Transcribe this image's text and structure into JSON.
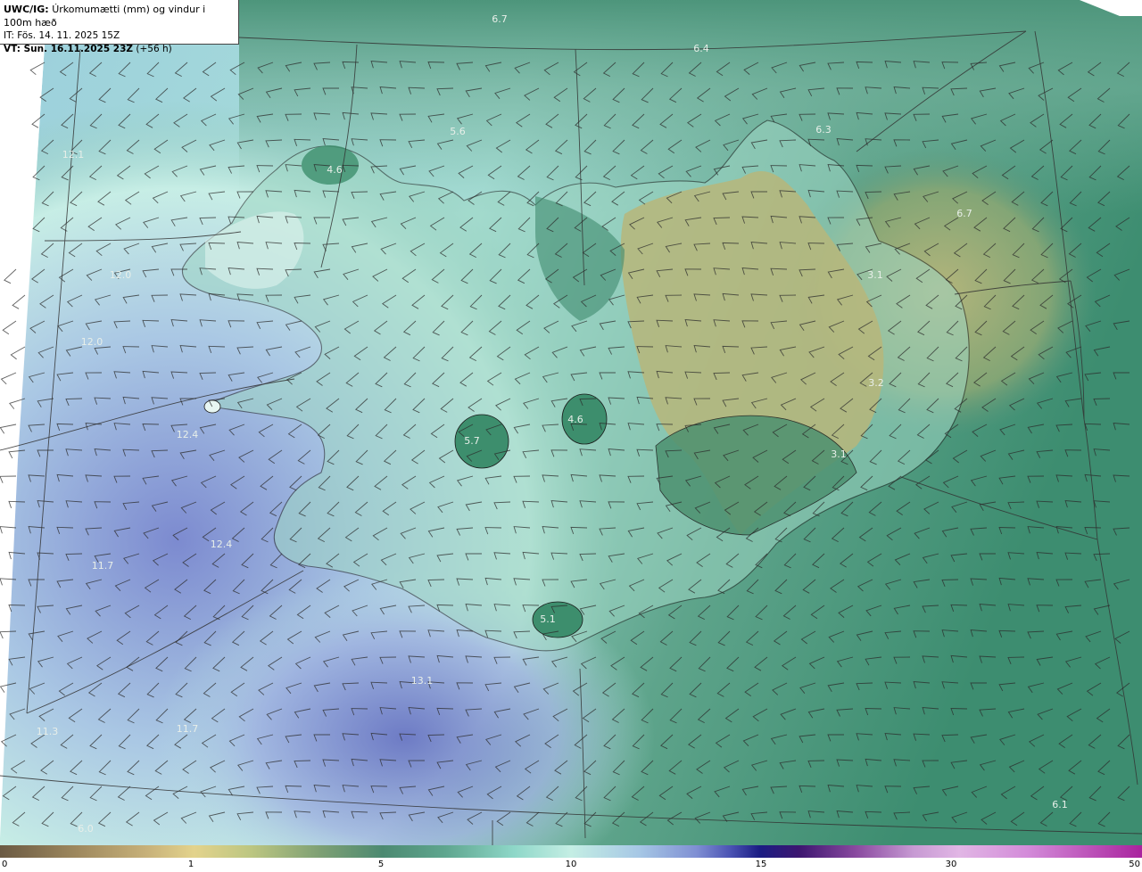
{
  "header": {
    "model_label": "UWC/IG:",
    "title": "Úrkomumætti (mm) og vindur i 100m hæð",
    "init_time": "IT: Fös. 14. 11. 2025 15Z",
    "valid_time": "VT: Sun. 16.11.2025 23Z",
    "lead_time": "(+56 h)"
  },
  "colorbar": {
    "ticks": [
      "0",
      "1",
      "5",
      "10",
      "15",
      "30",
      "50"
    ]
  },
  "value_labels": [
    {
      "text": "6.7"
    },
    {
      "text": "6.4"
    },
    {
      "text": "5.6"
    },
    {
      "text": "6.3"
    },
    {
      "text": "12.1"
    },
    {
      "text": "4.6"
    },
    {
      "text": "6.7"
    },
    {
      "text": "12.0"
    },
    {
      "text": "3.1"
    },
    {
      "text": "12.0"
    },
    {
      "text": "3.2"
    },
    {
      "text": "4.6"
    },
    {
      "text": "12.4"
    },
    {
      "text": "5.7"
    },
    {
      "text": "3.1"
    },
    {
      "text": "12.4"
    },
    {
      "text": "11.7"
    },
    {
      "text": "5.1"
    },
    {
      "text": "13.1"
    },
    {
      "text": "11.7"
    },
    {
      "text": "11.3"
    },
    {
      "text": "6.1"
    },
    {
      "text": "6.0"
    }
  ],
  "colors": {
    "low_precip": "#6fa58c",
    "dry_highland": "#b5b478",
    "moderate_precip": "#bfece2",
    "heavy_precip": "#6f7ec8",
    "ocean_edge": "#3e8a6e"
  }
}
